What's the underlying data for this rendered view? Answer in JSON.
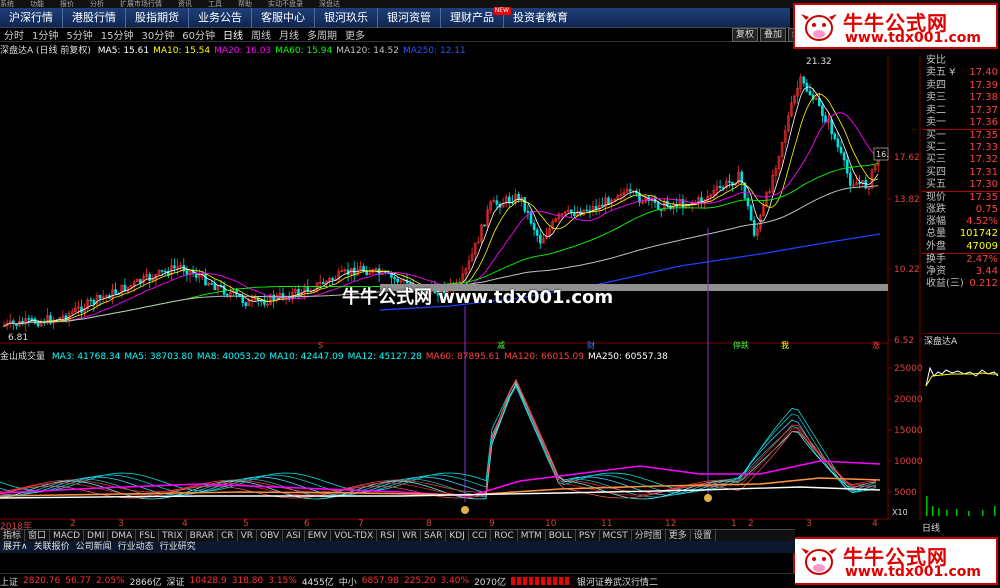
{
  "menubar": [
    "系统",
    "功能",
    "报价",
    "分析",
    "扩展市场行情",
    "资讯",
    "工具",
    "帮助",
    "实动不盘录",
    "深盘达"
  ],
  "nav": {
    "tabs": [
      "沪深行情",
      "港股行情",
      "股指期货",
      "业务公告",
      "客服中心",
      "银河玖乐",
      "银河资管",
      "理财产品",
      "投资者教育"
    ],
    "new_badge": "NEW"
  },
  "periods": [
    "分时",
    "1分钟",
    "5分钟",
    "15分钟",
    "30分钟",
    "60分钟",
    "日线",
    "周线",
    "月线",
    "多周期",
    "更多"
  ],
  "active_period": "日线",
  "right_buttons": [
    "复权",
    "叠加",
    "统计"
  ],
  "ma_legend": {
    "stock": "深盘达A (日线 前复权)",
    "items": [
      {
        "text": "MA5: 15.61",
        "color": "#ffffff"
      },
      {
        "text": "MA10: 15.54",
        "color": "#ffff00"
      },
      {
        "text": "MA20: 16.03",
        "color": "#ff00ff"
      },
      {
        "text": "MA60: 15.94",
        "color": "#00ff00"
      },
      {
        "text": "MA120: 14.52",
        "color": "#c0c0c0"
      },
      {
        "text": "MA250: 12.11",
        "color": "#3050ff"
      }
    ]
  },
  "vol_legend": {
    "title": "金山成交量",
    "items": [
      {
        "text": "MA3: 41768.34",
        "color": "#00ffff"
      },
      {
        "text": "MA5: 38703.80",
        "color": "#00ffff"
      },
      {
        "text": "MA8: 40053.20",
        "color": "#00ffff"
      },
      {
        "text": "MA10: 42447.09",
        "color": "#00ffff"
      },
      {
        "text": "MA12: 45127.28",
        "color": "#00ffff"
      },
      {
        "text": "MA60: 87895.61",
        "color": "#ff4040"
      },
      {
        "text": "MA120: 66015.09",
        "color": "#ff4040"
      },
      {
        "text": "MA250: 60557.38",
        "color": "#ffffff"
      }
    ]
  },
  "price_axis": [
    "17.62",
    "13.82",
    "10.22",
    "6.52"
  ],
  "price_annotations": {
    "high": "21.32",
    "low": "6.81",
    "last_tag": "16."
  },
  "vol_axis": [
    "25000",
    "20000",
    "15000",
    "10000",
    "5000"
  ],
  "vol_axis_unit": "X10",
  "dates": [
    "2018年",
    "2",
    "3",
    "4",
    "5",
    "6",
    "7",
    "8",
    "9",
    "10",
    "11",
    "12",
    "1",
    "2",
    "3",
    "4"
  ],
  "markers": [
    {
      "text": "S",
      "color": "#ff4040"
    },
    {
      "text": "减",
      "color": "#40ff40"
    },
    {
      "text": "财",
      "color": "#4080ff"
    },
    {
      "text": "停跌",
      "color": "#40ff40"
    },
    {
      "text": "我",
      "color": "#ffff00"
    },
    {
      "text": "涨",
      "color": "#ff4040"
    }
  ],
  "watermark": "牛牛公式网 www.tdx001.com",
  "quote": {
    "rows": [
      {
        "k": "安比",
        "v": ""
      },
      {
        "k": "卖五 ¥",
        "v": "17.40"
      },
      {
        "k": "卖四",
        "v": "17.39"
      },
      {
        "k": "卖三",
        "v": "17.38"
      },
      {
        "k": "卖二",
        "v": "17.37"
      },
      {
        "k": "卖一",
        "v": "17.36"
      },
      {
        "k": "买一",
        "v": "17.35"
      },
      {
        "k": "买二",
        "v": "17.33"
      },
      {
        "k": "买三",
        "v": "17.32"
      },
      {
        "k": "买四",
        "v": "17.31"
      },
      {
        "k": "买五",
        "v": "17.30"
      },
      {
        "k": "现价",
        "v": "17.35"
      },
      {
        "k": "涨跌",
        "v": "0.75"
      },
      {
        "k": "涨幅",
        "v": "4.52%"
      },
      {
        "k": "总量",
        "v": "101742"
      },
      {
        "k": "外盘",
        "v": "47009"
      },
      {
        "k": "换手",
        "v": "2.47%"
      },
      {
        "k": "净资",
        "v": "3.44"
      },
      {
        "k": "收益(三)",
        "v": "0.212"
      }
    ],
    "mini_title": "深盘达A",
    "mini_tab": "日线"
  },
  "logo": {
    "cn": "牛牛公式网",
    "url": "www.tdx001.com"
  },
  "bottom_tabs": [
    "指标",
    "窗口",
    "MACD",
    "DMI",
    "DMA",
    "FSL",
    "TRIX",
    "BRAR",
    "CR",
    "VR",
    "OBV",
    "ASI",
    "EMV",
    "VOL-TDX",
    "RSI",
    "WR",
    "SAR",
    "KDJ",
    "CCI",
    "ROC",
    "MTM",
    "BOLL",
    "PSY",
    "MCST",
    "分时图",
    "更多",
    "设置"
  ],
  "sub_tabs": [
    "展开∧",
    "关联报价",
    "公司新闻",
    "行业动态",
    "行业研究"
  ],
  "status": [
    {
      "text": "上证",
      "cls": "white"
    },
    {
      "text": "2820.76",
      "cls": "red"
    },
    {
      "text": "56.77",
      "cls": "red"
    },
    {
      "text": "2.05%",
      "cls": "red"
    },
    {
      "text": "2866亿",
      "cls": "white"
    },
    {
      "text": "深证",
      "cls": "white"
    },
    {
      "text": "10428.9",
      "cls": "red"
    },
    {
      "text": "318.80",
      "cls": "red"
    },
    {
      "text": "3.15%",
      "cls": "red"
    },
    {
      "text": "4455亿",
      "cls": "white"
    },
    {
      "text": "中小",
      "cls": "white"
    },
    {
      "text": "6857.98",
      "cls": "red"
    },
    {
      "text": "225.20",
      "cls": "red"
    },
    {
      "text": "3.40%",
      "cls": "red"
    },
    {
      "text": "2070亿",
      "cls": "white"
    },
    {
      "text": "银河证券武汉行情二",
      "cls": "white"
    }
  ]
}
